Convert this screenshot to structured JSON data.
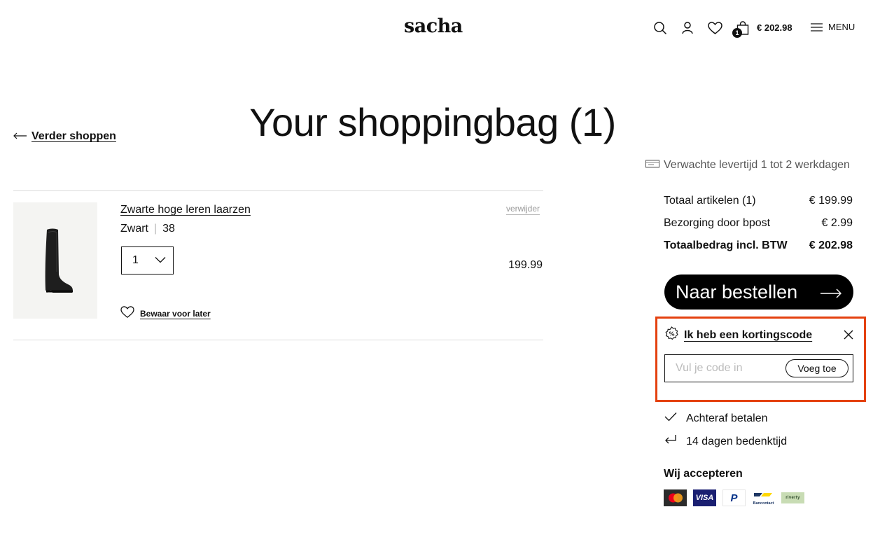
{
  "header": {
    "logo": "sacha",
    "cart_count": "1",
    "cart_total": "€ 202.98",
    "menu_label": "MENU",
    "icons": [
      "search-icon",
      "account-icon",
      "wishlist-heart-icon",
      "shopping-bag-icon",
      "hamburger-menu-icon"
    ]
  },
  "page": {
    "back_link": "Verder shoppen",
    "title": "Your shoppingbag (1)"
  },
  "cart": {
    "items": [
      {
        "name": "Zwarte hoge leren laarzen",
        "color": "Zwart",
        "size": "38",
        "quantity": "1",
        "remove_label": "verwijder",
        "price": "199.99",
        "save_later_label": "Bewaar voor later",
        "image": "black-knee-high-leather-boot"
      }
    ]
  },
  "summary": {
    "delivery_text": "Verwachte levertijd 1 tot 2 werkdagen",
    "rows": [
      {
        "label": "Totaal artikelen (1)",
        "value": "€ 199.99"
      },
      {
        "label": "Bezorging door bpost",
        "value": "€ 2.99"
      },
      {
        "label": "Totaalbedrag incl. BTW",
        "value": "€ 202.98"
      }
    ],
    "checkout_label": "Naar bestellen",
    "discount": {
      "title": "Ik heb een kortingscode",
      "placeholder": "Vul je code in",
      "value": "",
      "button_label": "Voeg toe"
    },
    "usps": [
      "Achteraf betalen",
      "14 dagen bedenktijd"
    ],
    "accept_title": "Wij accepteren",
    "payment_methods": [
      {
        "name": "Mastercard",
        "label": ""
      },
      {
        "name": "Visa",
        "label": "VISA"
      },
      {
        "name": "PayPal",
        "label": "P"
      },
      {
        "name": "Bancontact",
        "label": "Bancontact"
      },
      {
        "name": "Riverty",
        "label": "riverty"
      }
    ]
  },
  "colors": {
    "text": "#111111",
    "accent_outline": "#e4410f",
    "button_bg": "#000000",
    "muted": "#999999",
    "divider": "#dcdcdc"
  }
}
